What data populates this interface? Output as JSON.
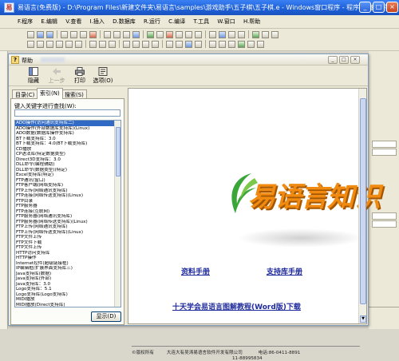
{
  "ide": {
    "title": "易语言(免费版) - D:\\Program Files\\新建文件夹\\易语言\\samples\\游戏助手\\五子棋\\五子棋.e - Windows窗口程序 - 程序集: 窗口程序",
    "menu": [
      "F.程序",
      "E.编辑",
      "V.查看",
      "I.插入",
      "D.数据库",
      "R.运行",
      "C.编译",
      "T.工具",
      "W.窗口",
      "H.帮助"
    ],
    "winbuttons": {
      "min": "_",
      "max": "□",
      "close": "×"
    }
  },
  "help": {
    "title": "帮助",
    "winbuttons": {
      "min": "_",
      "max": "□",
      "close": "×"
    },
    "toolbar": [
      {
        "label": "隐藏",
        "icon": "hide-icon",
        "enabled": true
      },
      {
        "label": "上一步",
        "icon": "back-arrow-icon",
        "enabled": false
      },
      {
        "label": "打印",
        "icon": "print-icon",
        "enabled": true
      },
      {
        "label": "选项(O)",
        "icon": "options-icon",
        "enabled": true
      }
    ],
    "tabs": [
      "目录(C)",
      "索引(N)",
      "搜索(S)"
    ],
    "active_tab": "索引(N)",
    "keyword_label": "键入关键字进行查找(W):",
    "keyword_value": "",
    "keywords": [
      "ADO操作(访问通讯支持库二)",
      "ADO操作(外部数据库支持库)(Linux)",
      "ADO数据(数据库操作支持库)",
      "BT下载支持库：3.0",
      "BT下载支持库：4.0(BT下载支持库)",
      "CD播放",
      "CP语法库(特定数据类型)",
      "Direct3D支持库：3.0",
      "DLL命令(编程辅助)",
      "DLL命令(数据类型)(特定)",
      "Excel支持库(特定)",
      "FTP通讯(窗口)",
      "FTP客户端(网络支持库)",
      "FTP上传(网络通讯支持库)",
      "FTP连接(网络传送支持库)(Linux)",
      "FTP目录",
      "FTP服务器",
      "FTP连接(互联网)",
      "FTP服务器(网络通讯支持库)",
      "FTP服务器(网络传送支持库)(Linux)",
      "FTP上传(网络通讯支持库)",
      "FTP上传(网络传送支持库)(Linux)",
      "FTP文件上传",
      "FTP文件下载",
      "FTP文件上传",
      "HTTP访问支持库",
      "HTTP操作",
      "Internet控件(超级链接框)",
      "IP编辑框(扩展界面支持库三)",
      "Java支持库(数据)",
      "Java支持库(外部)",
      "Java支持库：3.0",
      "Logo支持库：5.1",
      "Logo支持库(Logo支持库)",
      "MIDI播放",
      "MIDI播放(Direct支持库)",
      "MySql支持库",
      "MySql支持库(MySql支持库)(Linux)",
      "MySql支持库(Linux)",
      "MySql支持库(Linux)",
      "MySql支持库(Linux)"
    ],
    "selected_keyword_index": 0,
    "display_button": "显示(D)",
    "content": {
      "logo": "易语言知识",
      "link_manual": "资料手册",
      "link_support": "支持库手册",
      "link_tutorial": "十天学会易语言图解教程(Word版)下载",
      "footer_copyright": "©版权所有",
      "footer_company": "大连大有吴涛易语言软件开发有限公司",
      "footer_phone_label": "电话:86-0411-8891",
      "footer_phone2": "11-88995834"
    }
  }
}
